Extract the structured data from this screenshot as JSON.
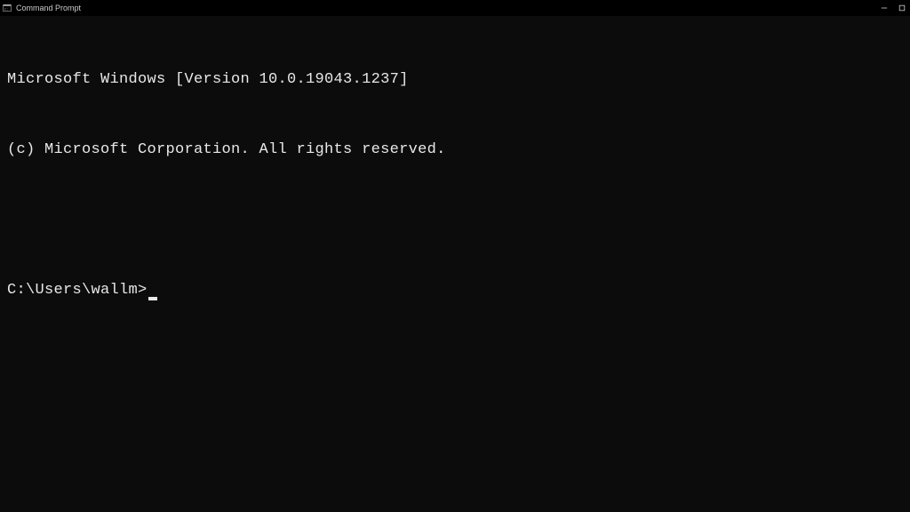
{
  "window": {
    "title": "Command Prompt"
  },
  "terminal": {
    "line1": "Microsoft Windows [Version 10.0.19043.1237]",
    "line2": "(c) Microsoft Corporation. All rights reserved.",
    "prompt": "C:\\Users\\wallm>"
  }
}
